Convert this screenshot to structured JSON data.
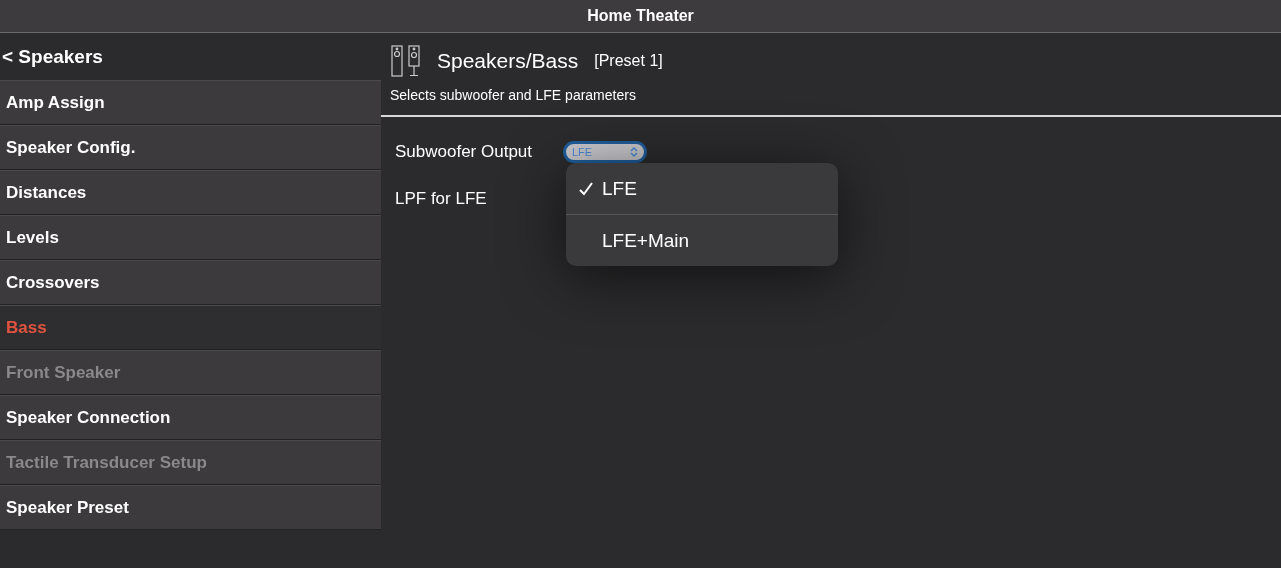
{
  "window": {
    "title": "Home Theater"
  },
  "sidebar": {
    "back": "< Speakers",
    "items": [
      {
        "label": "Amp Assign",
        "selected": false,
        "disabled": false
      },
      {
        "label": "Speaker Config.",
        "selected": false,
        "disabled": false
      },
      {
        "label": "Distances",
        "selected": false,
        "disabled": false
      },
      {
        "label": "Levels",
        "selected": false,
        "disabled": false
      },
      {
        "label": "Crossovers",
        "selected": false,
        "disabled": false
      },
      {
        "label": "Bass",
        "selected": true,
        "disabled": false
      },
      {
        "label": "Front Speaker",
        "selected": false,
        "disabled": true
      },
      {
        "label": "Speaker Connection",
        "selected": false,
        "disabled": false
      },
      {
        "label": "Tactile Transducer Setup",
        "selected": false,
        "disabled": true
      },
      {
        "label": "Speaker Preset",
        "selected": false,
        "disabled": false
      }
    ]
  },
  "header": {
    "title": "Speakers/Bass",
    "preset": "[Preset 1]",
    "description": "Selects subwoofer and LFE parameters"
  },
  "settings": [
    {
      "label": "Subwoofer Output",
      "kind": "select",
      "value": "LFE",
      "expanded": true,
      "options": [
        {
          "label": "LFE",
          "selected": true
        },
        {
          "label": "LFE+Main",
          "selected": false
        }
      ]
    },
    {
      "label": "LPF for LFE",
      "kind": "hidden"
    }
  ]
}
